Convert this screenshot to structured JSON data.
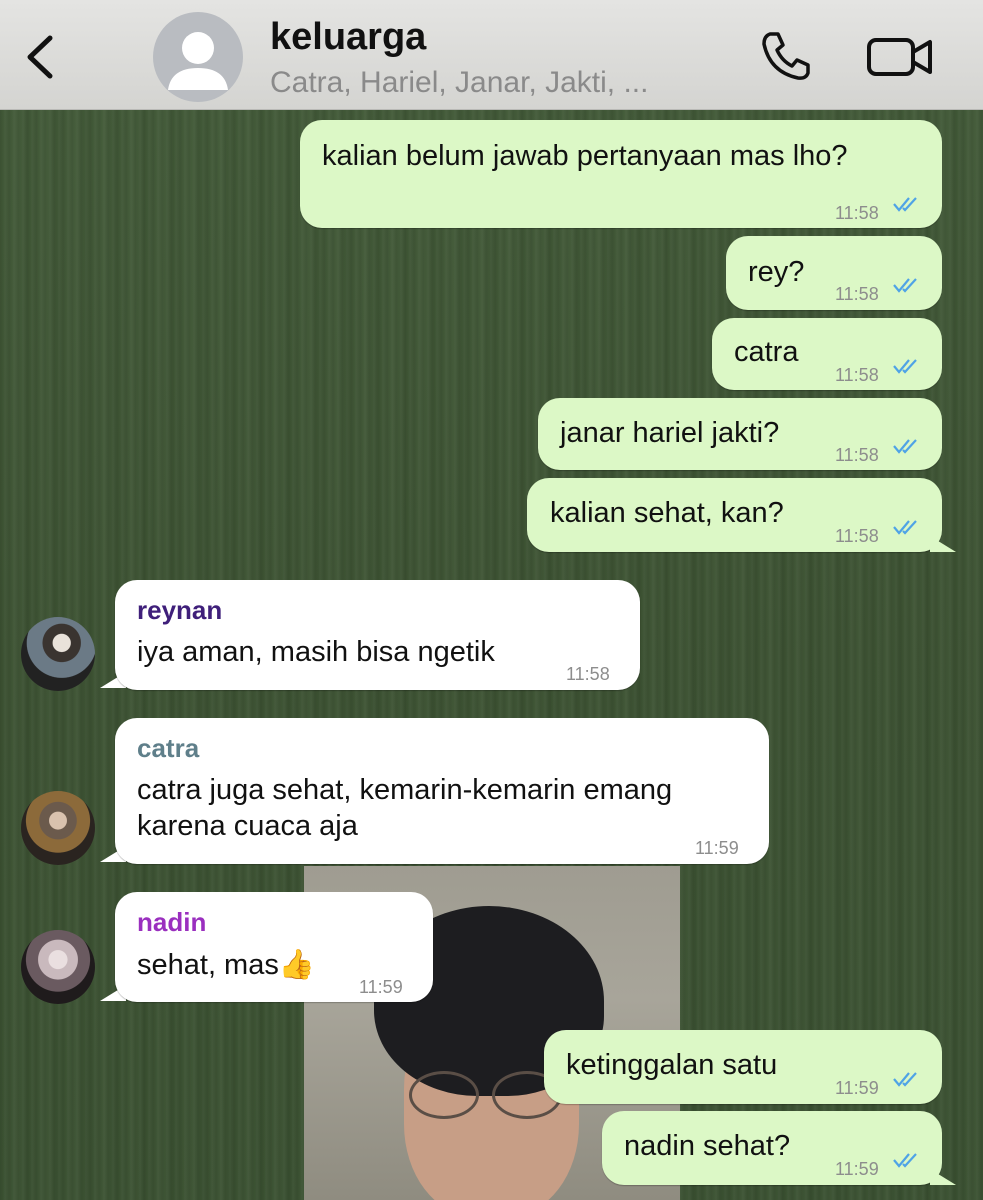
{
  "header": {
    "title": "keluarga",
    "subtitle": "Catra, Hariel, Janar, Jakti, ..."
  },
  "messages": [
    {
      "dir": "out",
      "text": "kalian belum jawab pertanyaan mas lho?",
      "time": "11:58",
      "status": "read"
    },
    {
      "dir": "out",
      "text": "rey?",
      "time": "11:58",
      "status": "read"
    },
    {
      "dir": "out",
      "text": "catra",
      "time": "11:58",
      "status": "read"
    },
    {
      "dir": "out",
      "text": "janar hariel jakti?",
      "time": "11:58",
      "status": "read"
    },
    {
      "dir": "out",
      "text": "kalian sehat, kan?",
      "time": "11:58",
      "status": "read"
    },
    {
      "dir": "in",
      "sender": "reynan",
      "text": "iya aman, masih bisa ngetik",
      "time": "11:58"
    },
    {
      "dir": "in",
      "sender": "catra",
      "text_line1": "catra juga sehat, kemarin-kemarin emang",
      "text_line2": "karena cuaca aja",
      "time": "11:59"
    },
    {
      "dir": "in",
      "sender": "nadin",
      "text": "sehat, mas👍",
      "time": "11:59"
    },
    {
      "dir": "out",
      "text": "ketinggalan satu",
      "time": "11:59",
      "status": "read"
    },
    {
      "dir": "out",
      "text": "nadin sehat?",
      "time": "11:59",
      "status": "read"
    }
  ],
  "colors": {
    "outgoing_bubble": "#dcf8c6",
    "incoming_bubble": "#ffffff",
    "read_ticks": "#4fa3e6",
    "sender_reynan": "#3f1f7a",
    "sender_catra": "#5f7f8a",
    "sender_nadin": "#9a2fbf"
  }
}
